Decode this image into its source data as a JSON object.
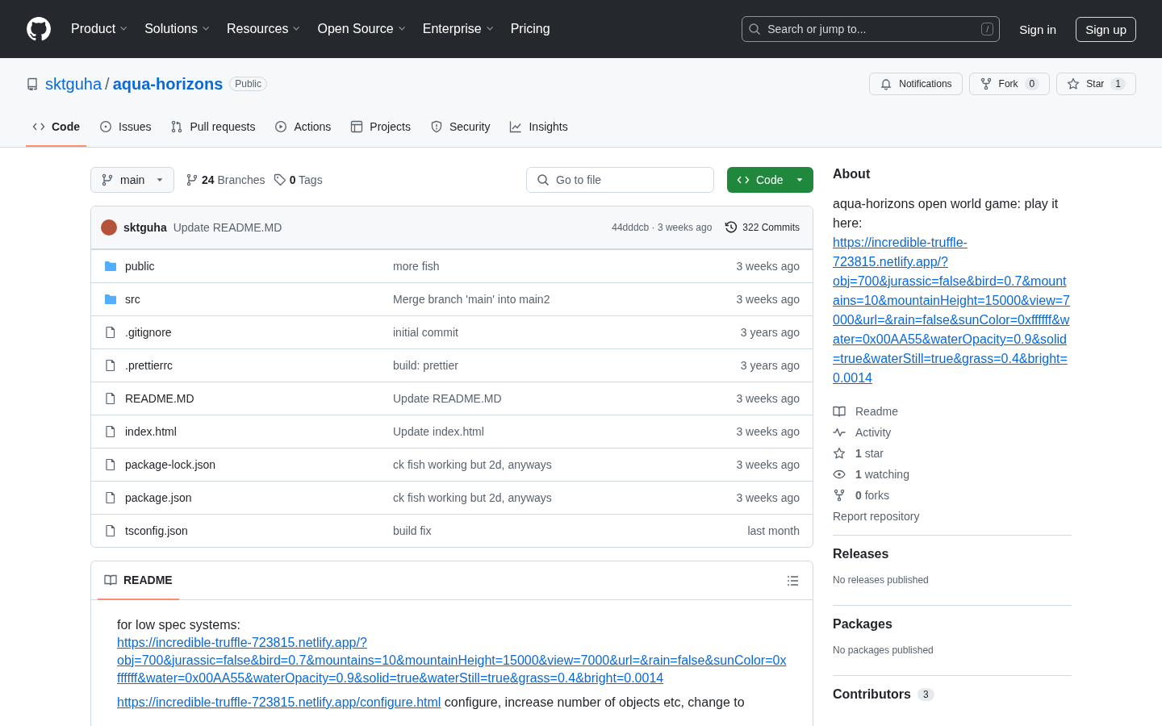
{
  "header": {
    "nav": [
      {
        "label": "Product",
        "dropdown": true
      },
      {
        "label": "Solutions",
        "dropdown": true
      },
      {
        "label": "Resources",
        "dropdown": true
      },
      {
        "label": "Open Source",
        "dropdown": true
      },
      {
        "label": "Enterprise",
        "dropdown": true
      },
      {
        "label": "Pricing",
        "dropdown": false
      }
    ],
    "search": {
      "placeholder": "Search or jump to...",
      "shortcut": "/"
    },
    "sign_in": "Sign in",
    "sign_up": "Sign up"
  },
  "repo": {
    "owner": "sktguha",
    "separator": "/",
    "name": "aqua-horizons",
    "visibility": "Public",
    "actions": [
      {
        "label": "Notifications"
      },
      {
        "label": "Fork",
        "count": "0"
      },
      {
        "label": "Star",
        "count": "1"
      }
    ]
  },
  "tabs": [
    {
      "label": "Code",
      "selected": true
    },
    {
      "label": "Issues",
      "selected": false
    },
    {
      "label": "Pull requests",
      "selected": false
    },
    {
      "label": "Actions",
      "selected": false
    },
    {
      "label": "Projects",
      "selected": false
    },
    {
      "label": "Security",
      "selected": false
    },
    {
      "label": "Insights",
      "selected": false
    }
  ],
  "branch_bar": {
    "branch": "main",
    "branches_count": "24",
    "branches_label": "Branches",
    "tags_count": "0",
    "tags_label": "Tags",
    "go_to_file": "Go to file",
    "code_button": "Code"
  },
  "commit": {
    "author": "sktguha",
    "message": "Update README.MD",
    "hash_time": "44dddcb · 3 weeks ago",
    "commits": "322 Commits"
  },
  "files": [
    {
      "kind": "folder",
      "name": "public",
      "message": "more fish",
      "time": "3 weeks ago"
    },
    {
      "kind": "folder",
      "name": "src",
      "message": "Merge branch 'main' into main2",
      "time": "3 weeks ago"
    },
    {
      "kind": "file",
      "name": ".gitignore",
      "message": "initial commit",
      "time": "3 years ago"
    },
    {
      "kind": "file",
      "name": ".prettierrc",
      "message": "build: prettier",
      "time": "3 years ago"
    },
    {
      "kind": "file",
      "name": "README.MD",
      "message": "Update README.MD",
      "time": "3 weeks ago"
    },
    {
      "kind": "file",
      "name": "index.html",
      "message": "Update index.html",
      "time": "3 weeks ago"
    },
    {
      "kind": "file",
      "name": "package-lock.json",
      "message": "ck fish working but 2d, anyways",
      "time": "3 weeks ago"
    },
    {
      "kind": "file",
      "name": "package.json",
      "message": "ck fish working but 2d, anyways",
      "time": "3 weeks ago"
    },
    {
      "kind": "file",
      "name": "tsconfig.json",
      "message": "build fix",
      "time": "last month"
    }
  ],
  "readme": {
    "title": "README",
    "paragraphs": [
      [
        {
          "kind": "text",
          "text": "for low spec systems: "
        },
        {
          "kind": "link",
          "text": "https://incredible-truffle-723815.netlify.app/?obj=700&jurassic=false&bird=0.7&mountains=10&mountainHeight=15000&view=7000&url=&rain=false&sunColor=0xffffff&water=0x00AA55&waterOpacity=0.9&solid=true&waterStill=true&grass=0.4&bright=0.0014"
        }
      ],
      [
        {
          "kind": "link",
          "text": "https://incredible-truffle-723815.netlify.app/configure.html"
        },
        {
          "kind": "text",
          "text": " configure, increase number of objects etc, change to"
        }
      ]
    ]
  },
  "about": {
    "title": "About",
    "description": "aqua-horizons open world game: play it here: ",
    "link": "https://incredible-truffle-723815.netlify.app/?obj=700&jurassic=false&bird=0.7&mountains=10&mountainHeight=15000&view=7000&url=&rain=false&sunColor=0xffffff&water=0x00AA55&waterOpacity=0.9&solid=true&waterStill=true&grass=0.4&bright=0.0014",
    "stats": [
      {
        "label": "Readme"
      },
      {
        "label": "Activity"
      },
      {
        "count": "1",
        "label": "star"
      },
      {
        "count": "1",
        "label": "watching"
      },
      {
        "count": "0",
        "label": "forks"
      }
    ],
    "report": "Report repository"
  },
  "sections": [
    {
      "title": "Releases",
      "note": "No releases published"
    },
    {
      "title": "Packages",
      "note": "No packages published"
    },
    {
      "title": "Contributors",
      "count": "3"
    }
  ]
}
